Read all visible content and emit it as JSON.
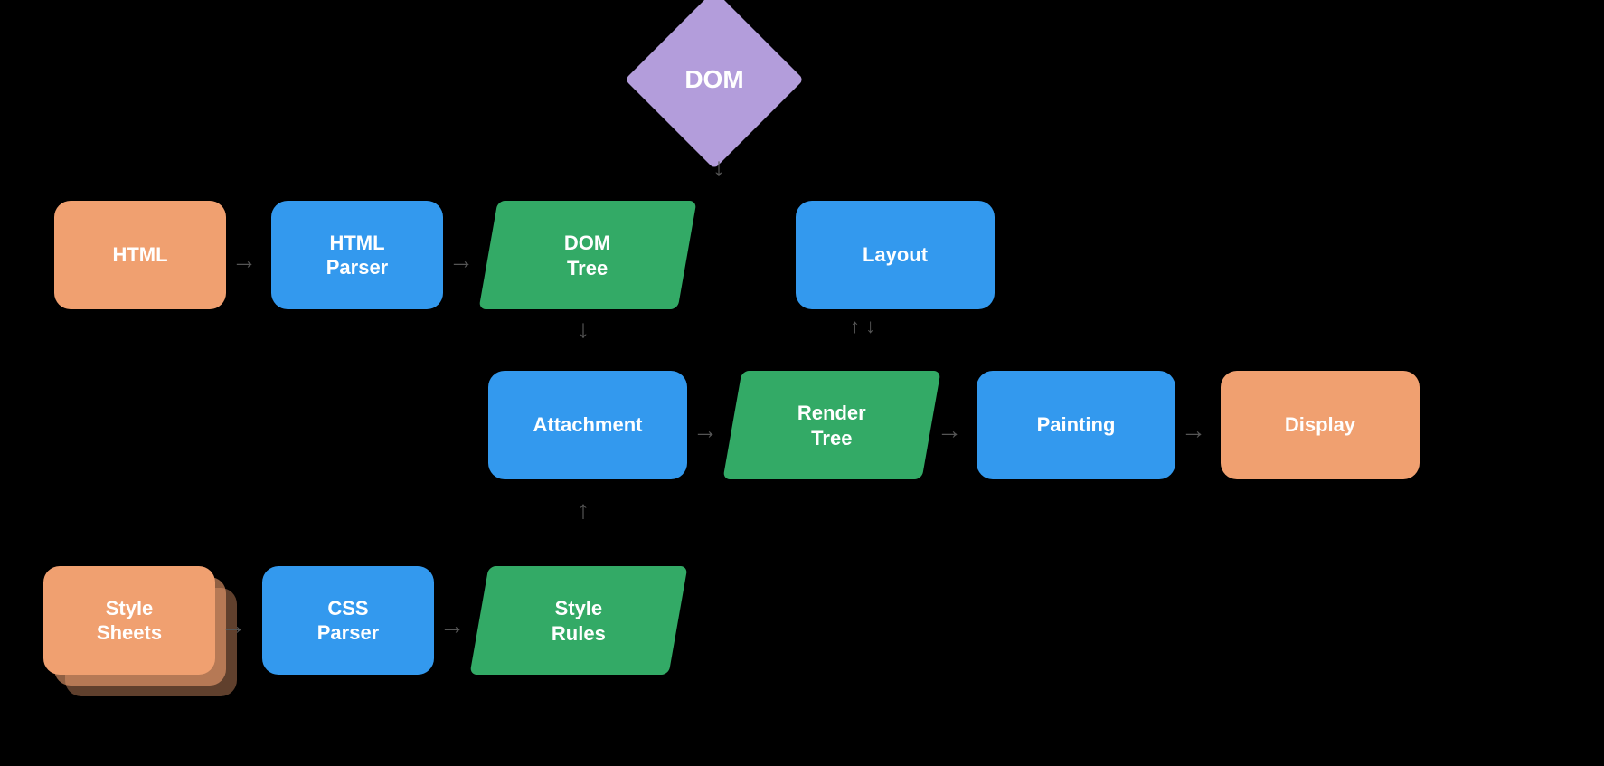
{
  "nodes": {
    "dom": {
      "label": "DOM"
    },
    "html": {
      "label": "HTML"
    },
    "html_parser": {
      "label": "HTML\nParser"
    },
    "dom_tree": {
      "label": "DOM\nTree"
    },
    "layout": {
      "label": "Layout"
    },
    "attachment": {
      "label": "Attachment"
    },
    "render_tree": {
      "label": "Render\nTree"
    },
    "painting": {
      "label": "Painting"
    },
    "display": {
      "label": "Display"
    },
    "style_sheets": {
      "label": "Style\nSheets"
    },
    "css_parser": {
      "label": "CSS\nParser"
    },
    "style_rules": {
      "label": "Style\nRules"
    }
  },
  "arrows": {
    "down": "↓",
    "right": "→",
    "up": "↑",
    "up_down": "↑↓"
  }
}
